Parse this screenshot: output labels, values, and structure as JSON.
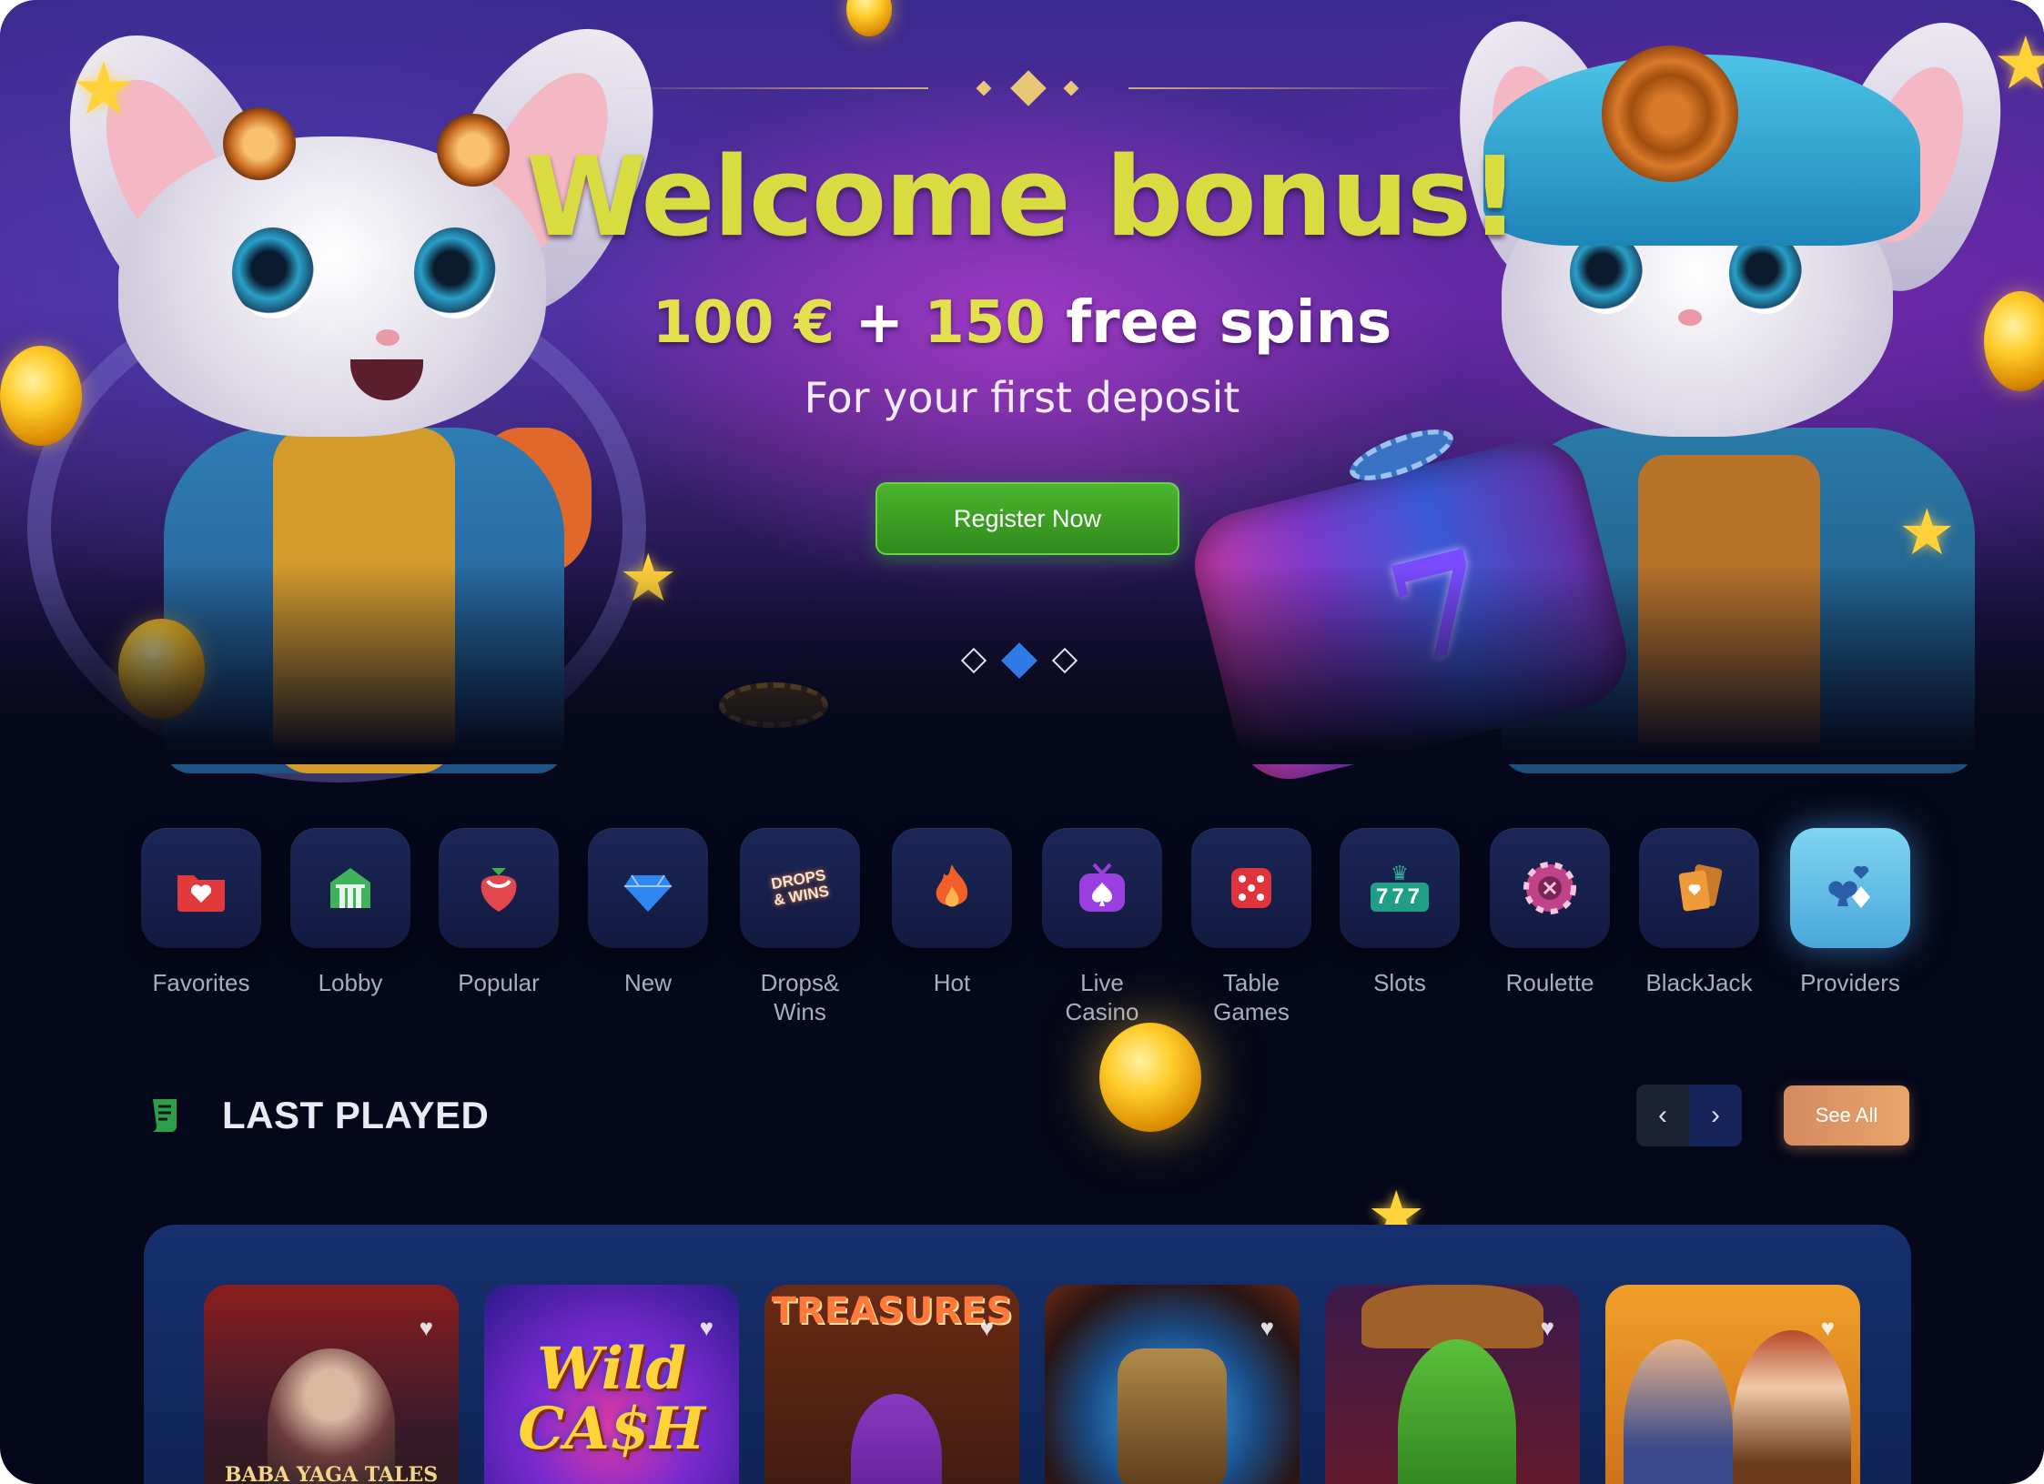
{
  "hero": {
    "title": "Welcome bonus!",
    "offer_amount": "100 €",
    "offer_plus": " + ",
    "offer_spins": "150",
    "offer_rest": " free spins",
    "subtitle": "For your first deposit",
    "cta_label": "Register Now",
    "slides_total": 3,
    "active_slide": 2
  },
  "categories": [
    {
      "label": "Favorites",
      "icon": "folder-heart-icon"
    },
    {
      "label": "Lobby",
      "icon": "lobby-building-icon"
    },
    {
      "label": "Popular",
      "icon": "strawberry-icon"
    },
    {
      "label": "New",
      "icon": "diamond-icon"
    },
    {
      "label": "Drops&\nWins",
      "icon": "drops-wins-badge-icon",
      "badge_text": "DROPS & WINS"
    },
    {
      "label": "Hot",
      "icon": "flame-icon"
    },
    {
      "label": "Live\nCasino",
      "icon": "tv-spade-icon"
    },
    {
      "label": "Table\nGames",
      "icon": "dice-icon"
    },
    {
      "label": "Slots",
      "icon": "slot-777-icon",
      "badge_text": "777"
    },
    {
      "label": "Roulette",
      "icon": "roulette-chip-icon"
    },
    {
      "label": "BlackJack",
      "icon": "playing-cards-icon"
    },
    {
      "label": "Providers",
      "icon": "card-suits-icon",
      "active": true
    }
  ],
  "last_played": {
    "title": "LAST PLAYED",
    "see_all_label": "See All",
    "prev_icon": "chevron-left-icon",
    "next_icon": "chevron-right-icon",
    "games": [
      {
        "name": "Baba Yaga Tales",
        "art_text": "BABA YAGA TALES"
      },
      {
        "name": "Wild Cash",
        "art_text": "Wild CA$H"
      },
      {
        "name": "Treasures",
        "art_text": "TREASURES"
      },
      {
        "name": "Aztec Mask",
        "art_text": ""
      },
      {
        "name": "Cactus Cowboy",
        "art_text": ""
      },
      {
        "name": "Couple",
        "art_text": ""
      }
    ]
  },
  "colors": {
    "background": "#05081a",
    "title_yellow": "#d8dc40",
    "cta_green": "#3a9d24",
    "accent_blue": "#2f7be6",
    "see_all": "#e9a56a"
  }
}
